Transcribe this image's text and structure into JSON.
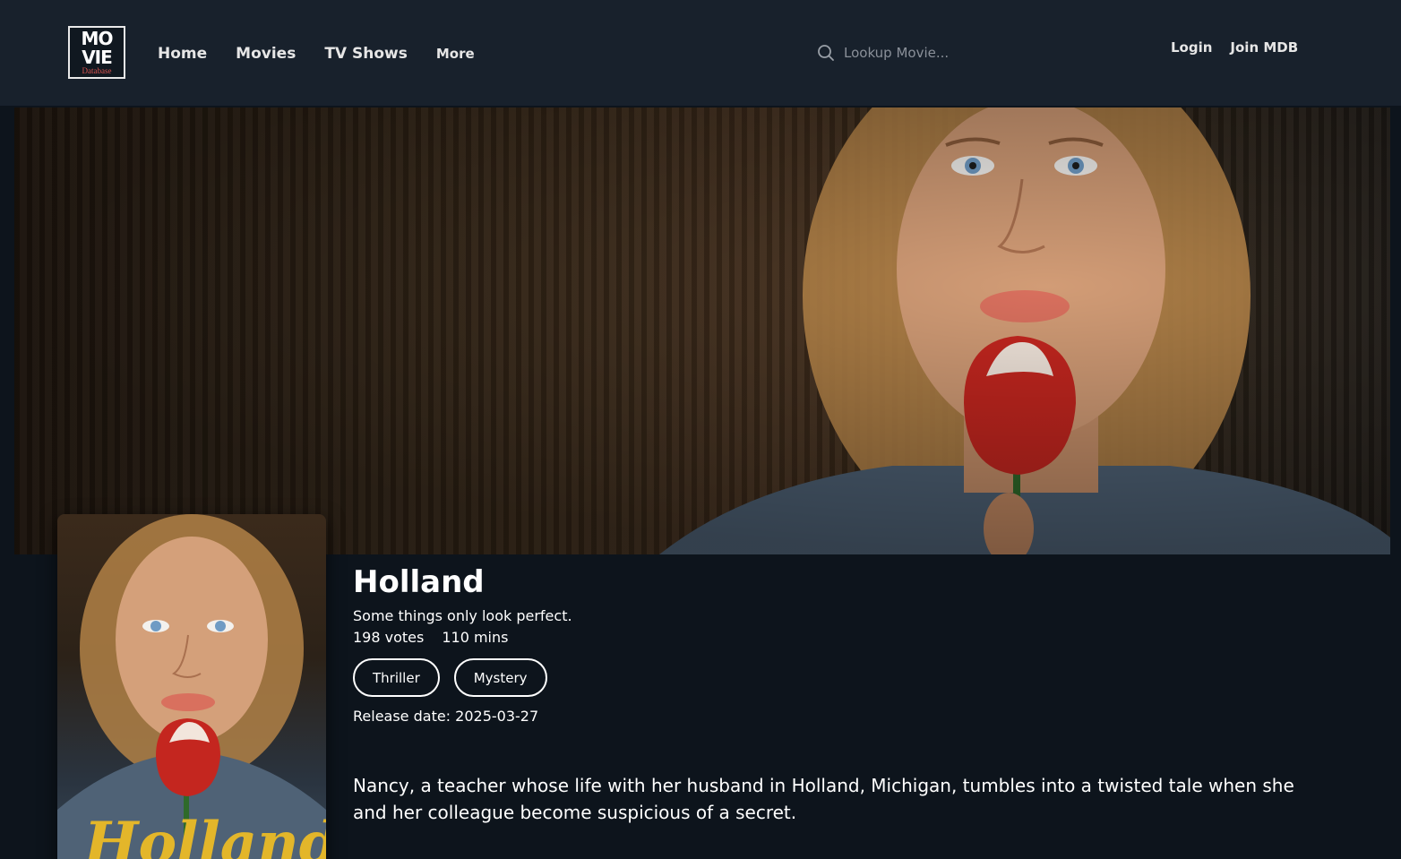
{
  "header": {
    "logo": {
      "line1": "MO",
      "line2": "VIE",
      "line3": "Database"
    },
    "nav": [
      {
        "label": "Home"
      },
      {
        "label": "Movies"
      },
      {
        "label": "TV Shows"
      },
      {
        "label": "More"
      }
    ],
    "search": {
      "placeholder": "Lookup Movie..."
    },
    "auth": {
      "login": "Login",
      "join": "Join MDB"
    }
  },
  "movie": {
    "title": "Holland",
    "tagline": "Some things only look perfect.",
    "votes": "198 votes",
    "runtime": "110 mins",
    "genres": [
      "Thriller",
      "Mystery"
    ],
    "release": "Release date: 2025-03-27",
    "overview": "Nancy, a teacher whose life with her husband in Holland, Michigan, tumbles into a twisted tale when she and her colleague become suspicious of a secret.",
    "poster_text": "Holland"
  },
  "colors": {
    "header_bg": "#18212c",
    "page_bg": "#0d141c",
    "poster_title": "#e3b62a"
  }
}
